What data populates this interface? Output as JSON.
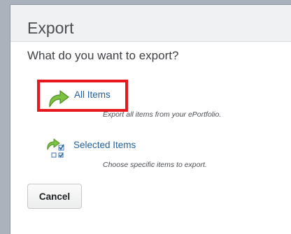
{
  "dialog": {
    "title": "Export",
    "question": "What do you want to export?"
  },
  "options": [
    {
      "label": "All Items",
      "description": "Export all items from your ePortfolio.",
      "icon": "export-arrow-icon"
    },
    {
      "label": "Selected Items",
      "description": "Choose specific items to export.",
      "icon": "export-selected-icon"
    }
  ],
  "buttons": {
    "cancel": "Cancel"
  },
  "colors": {
    "highlight": "#e6171d",
    "link": "#1f5f9e",
    "arrow_green": "#7cc243"
  }
}
